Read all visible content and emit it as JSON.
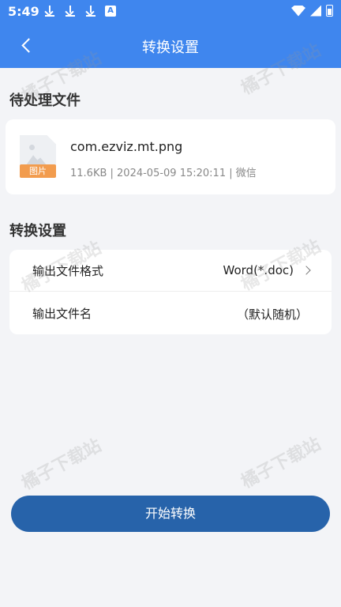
{
  "status_bar": {
    "time": "5:49",
    "left_icons": [
      "download-icon",
      "download-icon",
      "download-icon",
      "a-app-icon"
    ],
    "right_icons": [
      "wifi-icon",
      "signal-icon",
      "battery-icon"
    ]
  },
  "nav": {
    "title": "转换设置",
    "back_icon": "chevron-left-icon"
  },
  "pending_section": {
    "title": "待处理文件",
    "file": {
      "thumbnail_icon": "image-file-icon",
      "thumbnail_tag": "图片",
      "name": "com.ezviz.mt.png",
      "meta": "11.6KB | 2024-05-09 15:20:11 | 微信"
    }
  },
  "settings_section": {
    "title": "转换设置",
    "rows": [
      {
        "label": "输出文件格式",
        "value": "Word(*.doc)",
        "icon": "chevron-right-icon"
      },
      {
        "label": "输出文件名",
        "value": "（默认随机）"
      }
    ]
  },
  "action": {
    "start_label": "开始转换"
  },
  "watermark_text": "橘子下载站",
  "colors": {
    "header": "#3f86ee",
    "primary_button": "#2763aa",
    "file_tag": "#f29c4e",
    "background": "#f3f4f7"
  }
}
